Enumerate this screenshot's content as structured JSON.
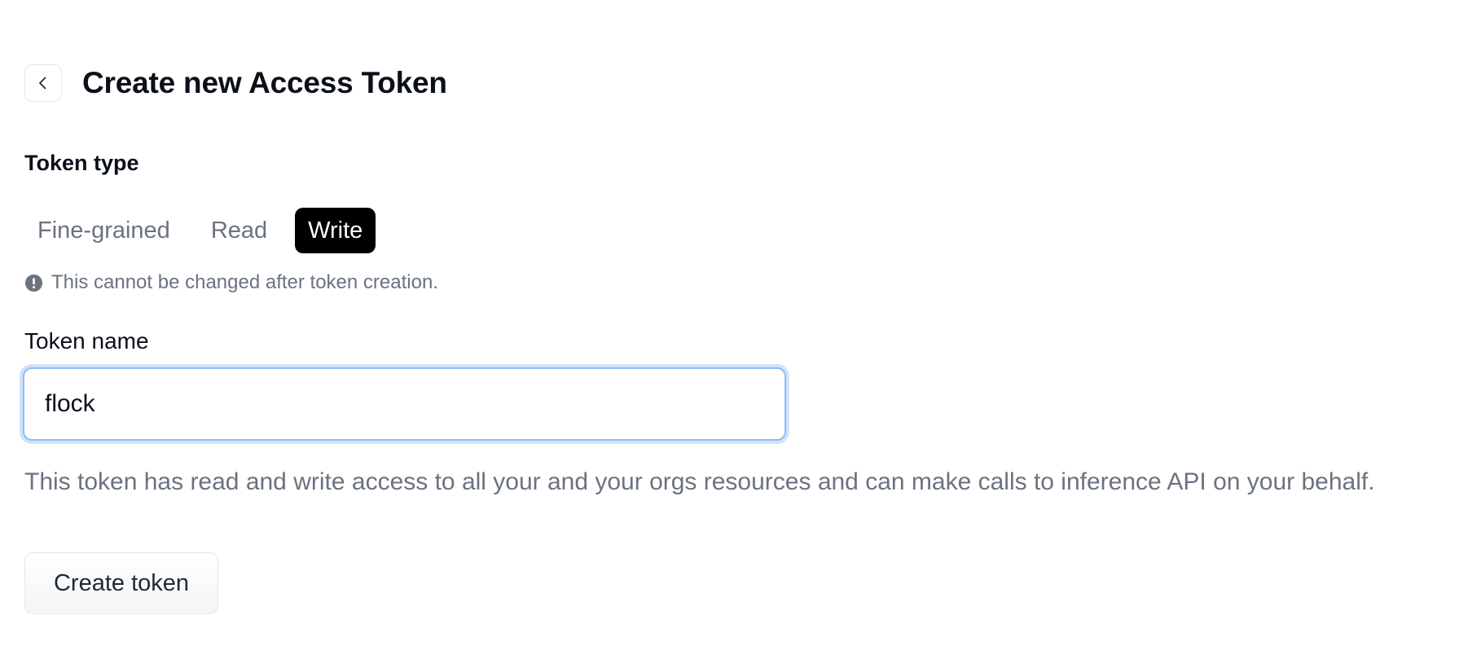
{
  "header": {
    "title": "Create new Access Token",
    "back_icon": "chevron-left-icon"
  },
  "token_type": {
    "label": "Token type",
    "options": [
      {
        "label": "Fine-grained",
        "selected": false
      },
      {
        "label": "Read",
        "selected": false
      },
      {
        "label": "Write",
        "selected": true
      }
    ],
    "note": "This cannot be changed after token creation.",
    "note_icon": "exclamation-circle-icon"
  },
  "token_name": {
    "label": "Token name",
    "value": "flock",
    "placeholder": ""
  },
  "description": "This token has read and write access to all your and your orgs resources and can make calls to inference API on your behalf.",
  "actions": {
    "create_label": "Create token"
  },
  "colors": {
    "selected_bg": "#000000",
    "selected_text": "#ffffff",
    "muted_text": "#6b7280",
    "focus_ring": "#8cbcf1"
  }
}
